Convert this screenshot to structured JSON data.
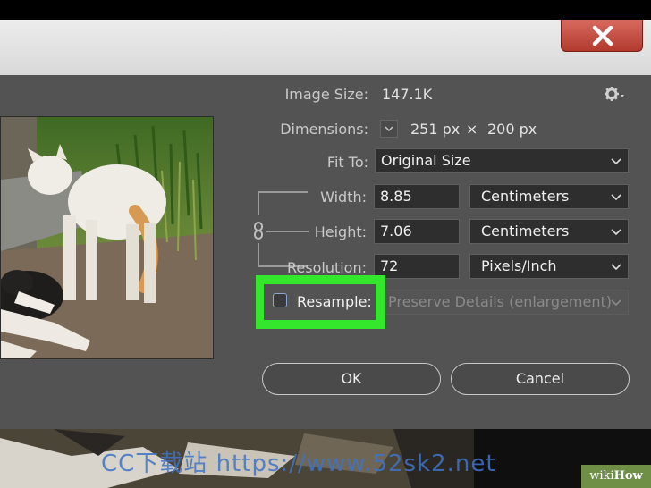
{
  "image_size": {
    "label": "Image Size:",
    "value": "147.1K"
  },
  "dimensions": {
    "label": "Dimensions:",
    "width": "251 px",
    "times": "×",
    "height": "200 px"
  },
  "fit_to": {
    "label": "Fit To:",
    "value": "Original Size"
  },
  "width": {
    "label": "Width:",
    "value": "8.85",
    "unit": "Centimeters"
  },
  "height": {
    "label": "Height:",
    "value": "7.06",
    "unit": "Centimeters"
  },
  "resolution": {
    "label": "Resolution:",
    "value": "72",
    "unit": "Pixels/Inch"
  },
  "resample": {
    "label": "Resample:",
    "checked": false,
    "method": "Preserve Details (enlargement)"
  },
  "buttons": {
    "ok": "OK",
    "cancel": "Cancel"
  },
  "watermark": "CC下载站 https://www.52sk2.net",
  "badge": {
    "wiki": "wiki",
    "how": "How"
  },
  "colors": {
    "highlight": "#34e72c",
    "dialog_bg": "#535353",
    "close_button": "#c0463a"
  },
  "icons": {
    "settings": "gear-icon",
    "close": "close-icon",
    "chain": "chain-link-icon",
    "dropdown": "chevron-down-icon"
  }
}
